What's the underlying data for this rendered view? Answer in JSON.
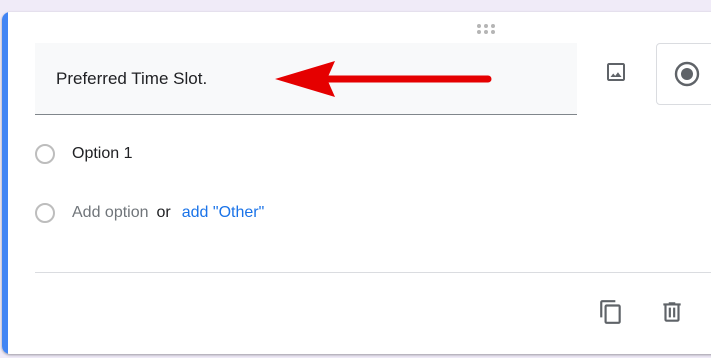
{
  "question": {
    "title": "Preferred Time Slot."
  },
  "options": [
    {
      "label": "Option 1"
    }
  ],
  "add_option": {
    "placeholder": "Add option",
    "or": "or",
    "add_other": "add \"Other\""
  },
  "colors": {
    "accent": "#4285f4",
    "arrow": "#e50000",
    "link": "#1a73e8"
  },
  "icons": {
    "drag": "drag-handle-icon",
    "image": "image-icon",
    "question_type": "radio-button-checked-icon",
    "copy": "copy-icon",
    "delete": "trash-icon"
  }
}
